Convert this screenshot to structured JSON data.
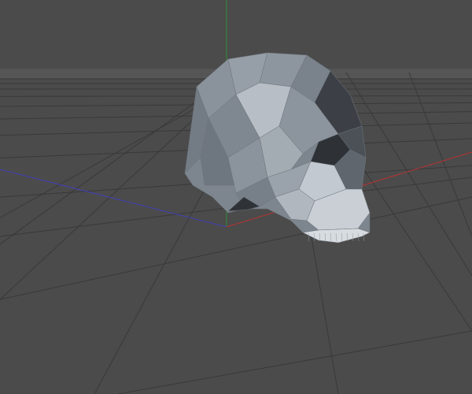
{
  "viewport": {
    "colors": {
      "background": "#4b4b4b",
      "grid": "#3a3a3a",
      "horizon": "#5a5a5a",
      "axis_x": "#b03030",
      "axis_y": "#2f8f3a",
      "axis_z": "#3a3ab0",
      "model_base": "#7f8790"
    },
    "model": {
      "name_icon": "low-poly-skull"
    }
  }
}
